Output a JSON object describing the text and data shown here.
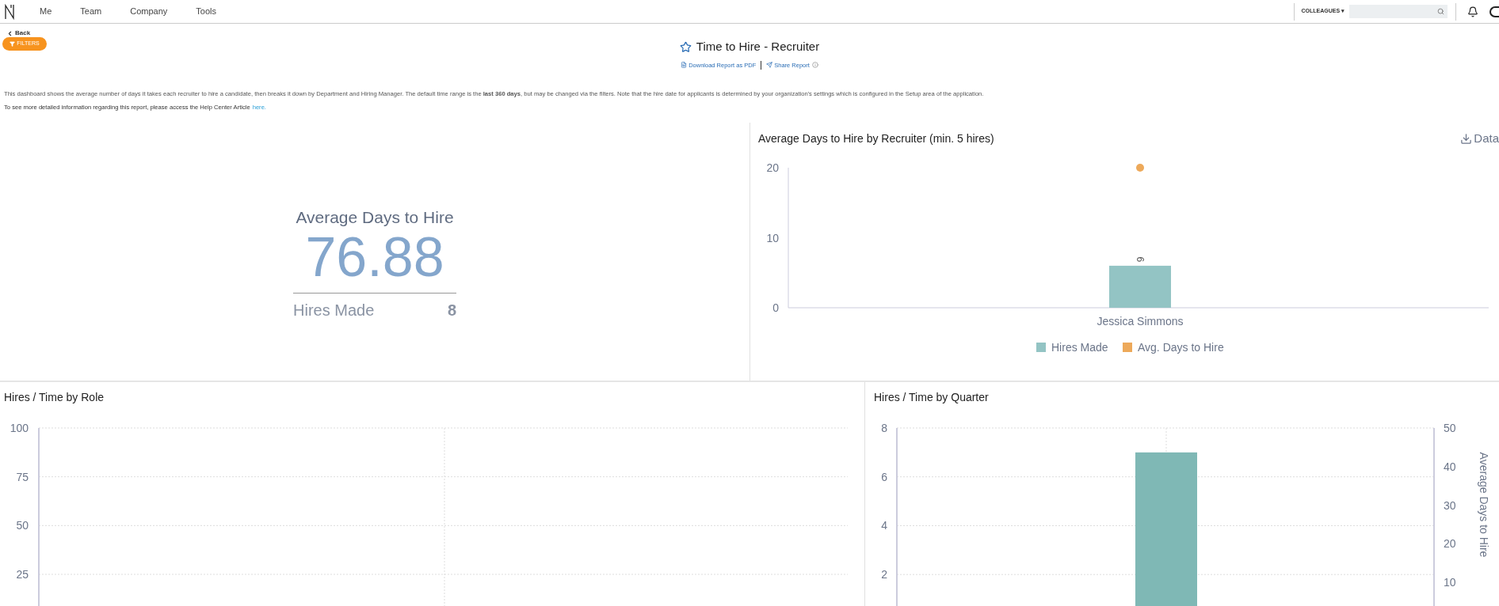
{
  "nav": {
    "items": [
      {
        "label": "Me"
      },
      {
        "label": "Team"
      },
      {
        "label": "Company"
      },
      {
        "label": "Tools"
      }
    ],
    "colleagues": "COLLEAGUES ▾"
  },
  "back": "Back",
  "filters": "FILTERS",
  "report": {
    "title": "Time to Hire - Recruiter",
    "starred": false,
    "links": [
      {
        "label": "Download Report as PDF"
      },
      {
        "label": "Share Report"
      }
    ]
  },
  "description": "This dashboard shows the average number of days it takes each recruiter to hire a candidate, then breaks it down by Department and Hiring Manager. The default time range is the **last 360 days**, but may be changed via the filters. Note that the hire date for applicants is determined by your organization's settings which is configured in the Setup area of the application.",
  "help": {
    "text": "To see more detailed information regarding this report, please access the Help Center Article",
    "link": "here."
  },
  "kpi": {
    "title": "Average Days to Hire",
    "value": "76.88",
    "sub_label": "Hires Made",
    "sub_value": "8"
  },
  "recruiter_panel": {
    "data_link": "Data",
    "chart_data": {
      "type": "bar",
      "title": "Average Days to Hire by Recruiter (min. 5 hires)",
      "categories": [
        "Jessica Simmons"
      ],
      "ylim": [
        0,
        20
      ],
      "yticks": [
        0,
        10,
        20
      ],
      "value_labels": [
        [
          "6"
        ],
        [
          null
        ]
      ],
      "legend": "bottom",
      "series": [
        {
          "name": "Hires Made",
          "type": "bar",
          "color": "#93c4c4",
          "values": [
            6
          ]
        },
        {
          "name": "Avg. Days to Hire",
          "type": "scatter",
          "color": "#eda95a",
          "values": [
            20
          ]
        }
      ]
    }
  },
  "role_panel": {
    "title": "Hires / Time by Role",
    "y_ticks": [
      "100",
      "75",
      "50",
      "25"
    ]
  },
  "quarter_panel": {
    "right_axis": {
      "label": "Average Days to Hire",
      "ticks": [
        "50",
        "40",
        "30",
        "20",
        "10"
      ]
    },
    "chart_data": {
      "type": "bar",
      "title": "Hires / Time by Quarter",
      "ylim": [
        0.71,
        8
      ],
      "yticks": [
        2,
        4,
        6,
        8
      ],
      "grid": true,
      "series": [
        {
          "color": "#7fb8b5",
          "values": [
            7
          ]
        }
      ]
    }
  }
}
